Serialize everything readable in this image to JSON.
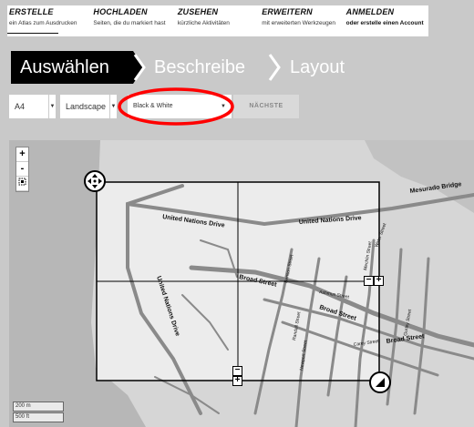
{
  "nav": [
    {
      "title": "ERSTELLE",
      "sub": "ein Atlas zum Ausdrucken"
    },
    {
      "title": "HOCHLADEN",
      "sub": "Seiten, die du markiert hast"
    },
    {
      "title": "ZUSEHEN",
      "sub": "kürzliche Aktivitäten"
    },
    {
      "title": "ERWEITERN",
      "sub": "mit erweiterten Werkzeugen"
    },
    {
      "title": "ANMELDEN",
      "sub": "oder erstelle einen Account"
    }
  ],
  "steps": [
    "Auswählen",
    "Beschreibe",
    "Layout"
  ],
  "controls": {
    "paper": "A4",
    "orientation": "Landscape",
    "style": "Black & White",
    "next": "NÄCHSTE"
  },
  "map": {
    "zoom_in": "+",
    "zoom_out": "-",
    "scale_m": "200 m",
    "scale_ft": "500 ft",
    "labels": {
      "mesurado_bridge": "Mesurado Bridge",
      "un_drive_top": "United Nations Drive",
      "un_drive_right": "United Nations Drive",
      "un_drive_vertical": "United Nations Drive",
      "broad_street_1": "Broad Street",
      "broad_street_2": "Broad Street",
      "broad_street_3": "Broad Street",
      "ashmun_street": "Ashmun Street",
      "carey_street": "Carey Street",
      "water_street": "Water Street",
      "mechlin_street": "Mechlin Street",
      "gurley_street": "Gurley Street",
      "benson_street": "Benson Street",
      "newport_street": "Newport Street",
      "randall_street": "Randall Street"
    },
    "colors": {
      "water": "#b7b7b7",
      "land": "#d6d6d6",
      "selection": "#ececec",
      "road": "#8a8a8a",
      "highlight": "#ff0000"
    }
  }
}
